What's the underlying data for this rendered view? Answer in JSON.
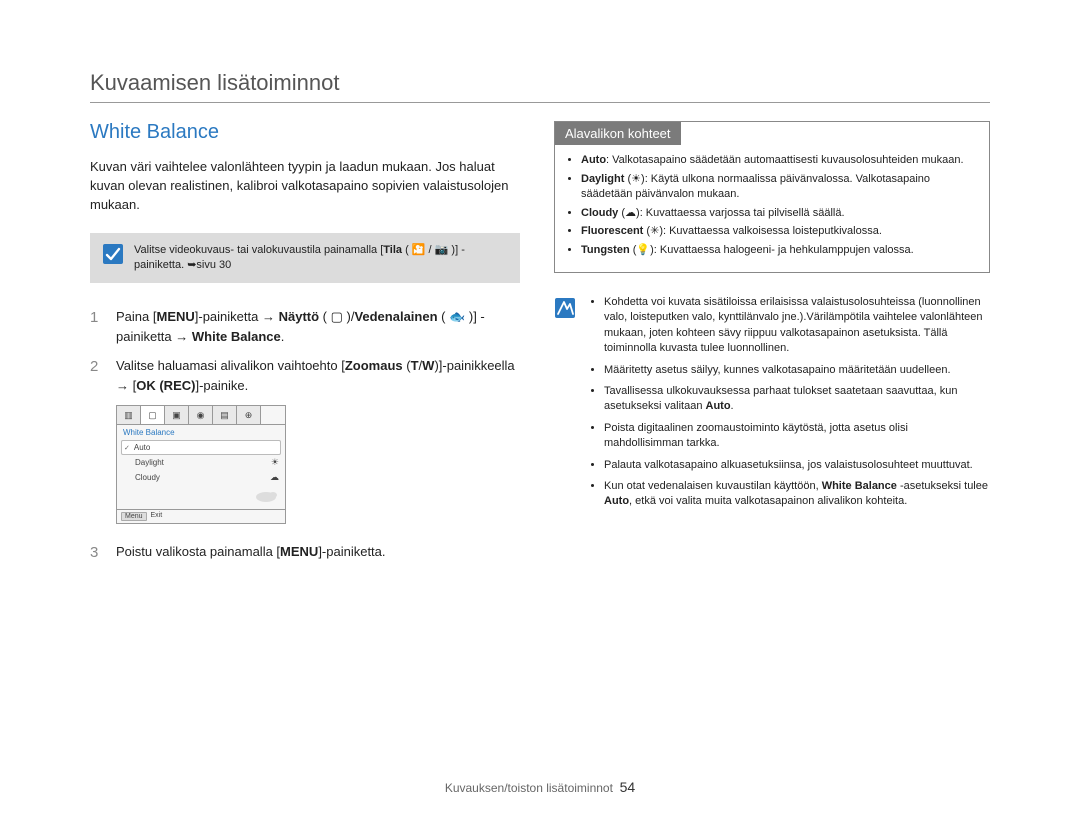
{
  "header": {
    "title": "Kuvaamisen lisätoiminnot"
  },
  "section": {
    "heading": "White Balance"
  },
  "intro": "Kuvan väri vaihtelee valonlähteen tyypin ja laadun mukaan. Jos haluat kuvan olevan realistinen, kalibroi valkotasapaino sopivien valaistusolojen mukaan.",
  "note": {
    "prefix": "Valitse videokuvaus- tai valokuvaustila painamalla [",
    "bold1": "Tila",
    "mid": " ( 🎦 / 📷 )] -painiketta. ",
    "arrow": "➥",
    "suffix": "sivu 30"
  },
  "steps": [
    {
      "n": "1",
      "parts": [
        {
          "t": "Paina ["
        },
        {
          "b": "MENU"
        },
        {
          "t": "]-painiketta → "
        },
        {
          "b": "Näyttö"
        },
        {
          "t": " ( ▢ )/"
        },
        {
          "b": "Vedenalainen"
        },
        {
          "t": " ( 🐟 )] -painiketta → "
        },
        {
          "b": "White Balance"
        },
        {
          "t": "."
        }
      ]
    },
    {
      "n": "2",
      "parts": [
        {
          "t": "Valitse haluamasi alivalikon vaihtoehto ["
        },
        {
          "b": "Zoomaus"
        },
        {
          "t": " ("
        },
        {
          "b": "T"
        },
        {
          "t": "/"
        },
        {
          "b": "W"
        },
        {
          "t": ")]-painikkeella → ["
        },
        {
          "b": "OK (REC)"
        },
        {
          "t": "]-painike."
        }
      ]
    },
    {
      "n": "3",
      "parts": [
        {
          "t": "Poistu valikosta painamalla ["
        },
        {
          "b": "MENU"
        },
        {
          "t": "]-painiketta."
        }
      ]
    }
  ],
  "figure": {
    "title": "White Balance",
    "items": [
      {
        "label": "Auto",
        "selected": true
      },
      {
        "label": "Daylight",
        "icon": "sun"
      },
      {
        "label": "Cloudy",
        "icon": "cloud"
      }
    ],
    "menu": "Menu",
    "exit": "Exit"
  },
  "sidebox": {
    "title": "Alavalikon kohteet",
    "items": [
      {
        "name": "Auto",
        "glyph": "",
        "desc": ": Valkotasapaino säädetään automaattisesti kuvausolosuhteiden mukaan."
      },
      {
        "name": "Daylight",
        "glyph": "☀",
        "desc": ": Käytä ulkona normaalissa päivänvalossa. Valkotasapaino säädetään päivänvalon mukaan."
      },
      {
        "name": "Cloudy",
        "glyph": "☁",
        "desc": ": Kuvattaessa varjossa tai pilvisellä säällä."
      },
      {
        "name": "Fluorescent",
        "glyph": "✳",
        "desc": ": Kuvattaessa valkoisessa loisteputkivalossa."
      },
      {
        "name": "Tungsten",
        "glyph": "💡",
        "desc": ": Kuvattaessa halogeeni- ja hehkulamppujen valossa."
      }
    ]
  },
  "info": {
    "items": [
      "Kohdetta voi kuvata sisätiloissa erilaisissa valaistusolosuhteissa (luonnollinen valo, loisteputken valo, kynttilänvalo jne.).Värilämpötila vaihtelee valonlähteen mukaan, joten kohteen sävy riippuu valkotasapainon asetuksista. Tällä toiminnolla kuvasta tulee luonnollinen.",
      "Määritetty asetus säilyy, kunnes valkotasapaino määritetään uudelleen.",
      "Tavallisessa ulkokuvauksessa parhaat tulokset saatetaan saavuttaa, kun asetukseksi valitaan Auto.",
      "Poista digitaalinen zoomaustoiminto käytöstä, jotta asetus olisi mahdollisimman tarkka.",
      "Palauta valkotasapaino alkuasetuksiinsa, jos valaistusolosuhteet muuttuvat.",
      "Kun otat vedenalaisen kuvaustilan käyttöön, White Balance -asetukseksi tulee Auto, etkä voi valita muita valkotasapainon alivalikon kohteita."
    ],
    "boldKeys": {
      "2": [
        "Auto"
      ],
      "5": [
        "White Balance",
        "Auto"
      ]
    }
  },
  "footer": {
    "section": "Kuvauksen/toiston lisätoiminnot",
    "page": "54"
  }
}
